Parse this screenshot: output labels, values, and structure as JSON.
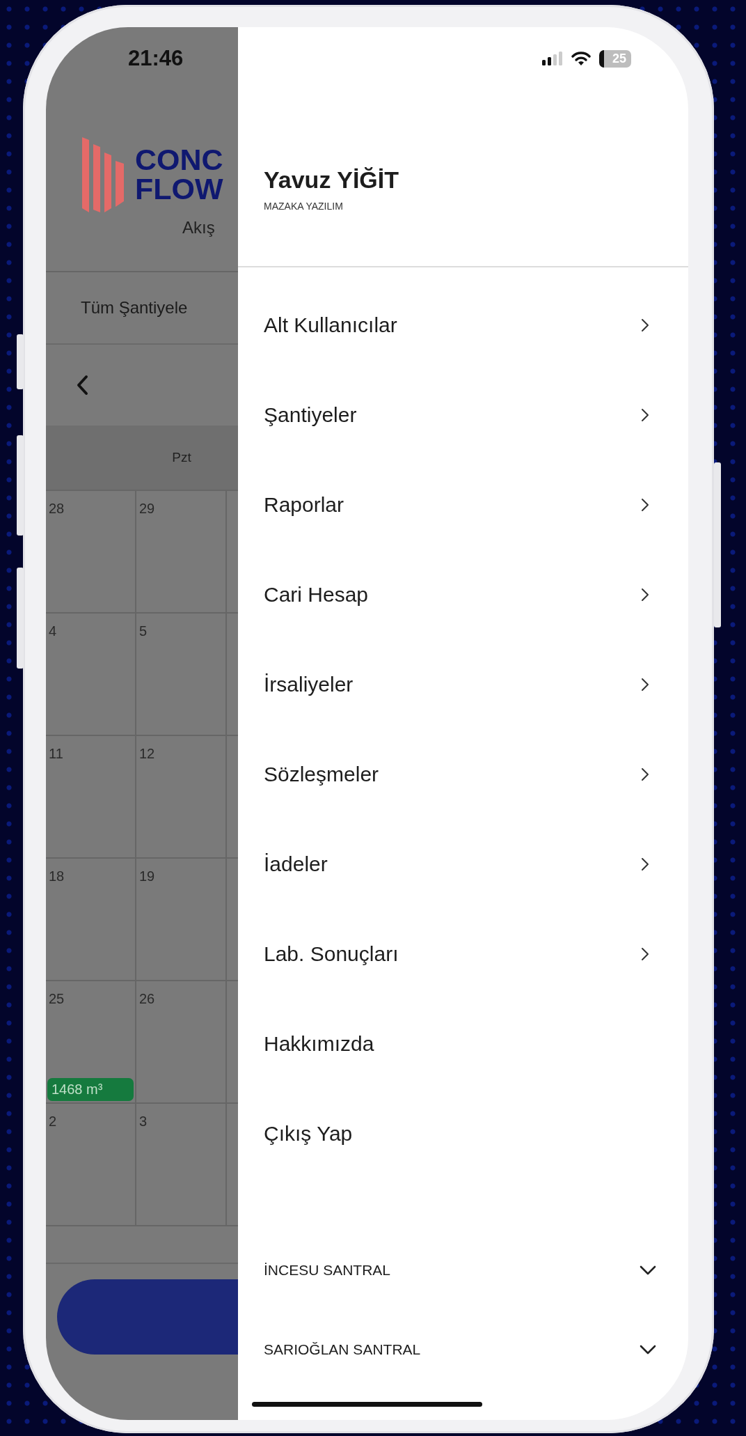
{
  "background_screen": {
    "time": "21:46",
    "logo": [
      "CONC",
      "FLOW"
    ],
    "subtitle": "Akış",
    "filter": "Tüm Şantiyele",
    "weekday": "Pzt",
    "calendar_rows": [
      [
        {
          "day": "28"
        },
        {
          "day": "29"
        }
      ],
      [
        {
          "day": "4"
        },
        {
          "day": "5"
        }
      ],
      [
        {
          "day": "11"
        },
        {
          "day": "12"
        }
      ],
      [
        {
          "day": "18"
        },
        {
          "day": "19"
        }
      ],
      [
        {
          "day": "25",
          "badge": "1468 m³"
        },
        {
          "day": "26"
        }
      ],
      [
        {
          "day": "2"
        },
        {
          "day": "3"
        }
      ]
    ]
  },
  "drawer": {
    "status_bar": {
      "battery": "25"
    },
    "user": {
      "name": "Yavuz YİĞİT",
      "company": "MAZAKA YAZILIM"
    },
    "menu": [
      {
        "label": "Alt Kullanıcılar",
        "has_arrow": true
      },
      {
        "label": "Şantiyeler",
        "has_arrow": true
      },
      {
        "label": "Raporlar",
        "has_arrow": true
      },
      {
        "label": "Cari Hesap",
        "has_arrow": true
      },
      {
        "label": "İrsaliyeler",
        "has_arrow": true
      },
      {
        "label": "Sözleşmeler",
        "has_arrow": true
      },
      {
        "label": "İadeler",
        "has_arrow": true
      },
      {
        "label": "Lab. Sonuçları",
        "has_arrow": true
      },
      {
        "label": "Hakkımızda",
        "has_arrow": false
      },
      {
        "label": "Çıkış Yap",
        "has_arrow": false
      }
    ],
    "sections": [
      {
        "label": "İNCESU SANTRAL",
        "expanded": false
      },
      {
        "label": "SARIOĞLAN SANTRAL",
        "expanded": false
      }
    ]
  }
}
